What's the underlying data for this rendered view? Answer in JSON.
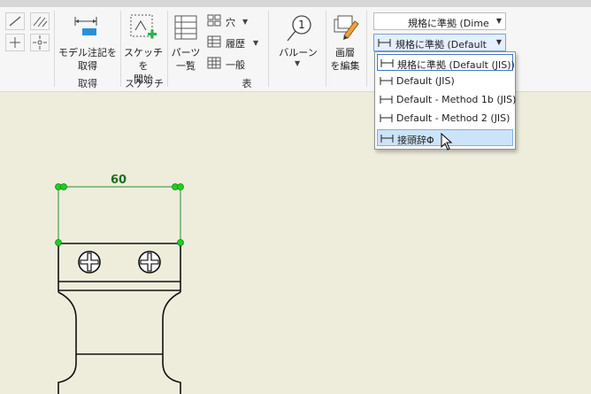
{
  "ribbon": {
    "groups": [
      {
        "label": "取得"
      },
      {
        "label": "スケッチ"
      },
      {
        "label": "表"
      }
    ],
    "buttons": {
      "model_annotation": "モデル注記を\n取得",
      "sketch_start": "スケッチを\n開始",
      "parts_list": "パーツ\n一覧",
      "hole": "穴",
      "revision": "履歴",
      "general": "一般",
      "balloon": "バルーン",
      "edit_layer": "画層\nを編集"
    },
    "style_dropdown": {
      "value": "規格に準拠 (Dime"
    },
    "dim_style_dropdown": {
      "value": "規格に準拠 (Default"
    },
    "balloon_number": "1"
  },
  "menu": {
    "items": [
      {
        "label": "規格に準拠 (Default (JIS))",
        "state": "selected"
      },
      {
        "label": "Default (JIS)",
        "state": "normal"
      },
      {
        "label": "Default - Method 1b (JIS)",
        "state": "normal"
      },
      {
        "label": "Default - Method 2 (JIS)",
        "state": "normal"
      },
      {
        "label": "接頭辞Φ",
        "state": "hover"
      }
    ]
  },
  "drawing": {
    "dimension_value": "60",
    "colors": {
      "dimension": "#1f7a1f",
      "grip": "#22cc22",
      "geometry": "#111111",
      "background": "#eeeddc"
    }
  }
}
